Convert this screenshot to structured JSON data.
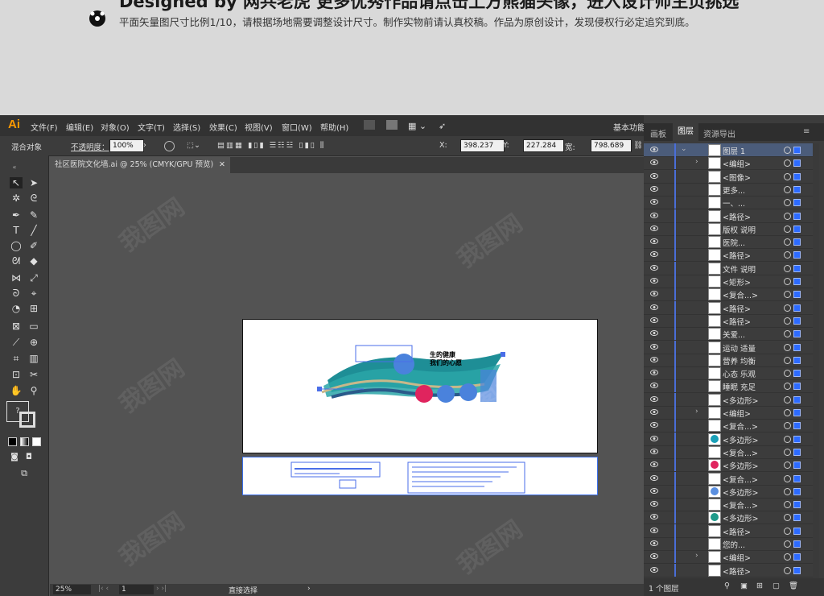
{
  "banner": {
    "headline": "Designed by 网共老虎    更多优秀作品请点击上方熊猫头像，进入设计师主页挑选",
    "subline": "平面矢量图尺寸比例1/10，请根据场地需要调整设计尺寸。制作实物前请认真校稿。作品为原创设计，发现侵权行必定追究到底。"
  },
  "app": {
    "logo": "Ai",
    "menu": [
      "文件(F)",
      "编辑(E)",
      "对象(O)",
      "文字(T)",
      "选择(S)",
      "效果(C)",
      "视图(V)",
      "窗口(W)",
      "帮助(H)"
    ],
    "workspace": "基本功能",
    "control": {
      "mode_label": "混合对象",
      "opacity_label": "不透明度：",
      "opacity_value": "100%",
      "x_label": "X:",
      "x_value": "398.237",
      "y_label": "Y:",
      "y_value": "227.284",
      "w_label": "宽:",
      "w_value": "798.689"
    },
    "document_tab": "社区医院文化墙.ai @ 25% (CMYK/GPU 预览)",
    "status": {
      "zoom": "25%",
      "page": "1",
      "tool": "直接选择"
    },
    "artwork": {
      "line1": "生的健康",
      "line2": "我们的心愿"
    }
  },
  "panel": {
    "tabs": [
      "画板",
      "图层",
      "资源导出"
    ],
    "active_tab": "图层",
    "layers": [
      {
        "name": "图层 1",
        "top": true
      },
      {
        "name": "<编组>",
        "caret": true
      },
      {
        "name": "<图像>"
      },
      {
        "name": "更多..."
      },
      {
        "name": "一、..."
      },
      {
        "name": "<路径>"
      },
      {
        "name": "版权 说明"
      },
      {
        "name": "医院..."
      },
      {
        "name": "<路径>"
      },
      {
        "name": "文件 说明"
      },
      {
        "name": "<矩形>"
      },
      {
        "name": "<复合...>"
      },
      {
        "name": "<路径>"
      },
      {
        "name": "<路径>"
      },
      {
        "name": "关爱..."
      },
      {
        "name": "运动 适量"
      },
      {
        "name": "营养 均衡"
      },
      {
        "name": "心态 乐观"
      },
      {
        "name": "睡眠 充足"
      },
      {
        "name": "<多边形>"
      },
      {
        "name": "<编组>",
        "caret": true
      },
      {
        "name": "<复合...>"
      },
      {
        "name": "<多边形>",
        "color": "#1aa0b8"
      },
      {
        "name": "<复合...>"
      },
      {
        "name": "<多边形>",
        "color": "#e0245e"
      },
      {
        "name": "<复合...>"
      },
      {
        "name": "<多边形>",
        "color": "#5a8fe0"
      },
      {
        "name": "<复合...>"
      },
      {
        "name": "<多边形>",
        "color": "#1e9a8a"
      },
      {
        "name": "<路径>"
      },
      {
        "name": "您的..."
      },
      {
        "name": "<编组>",
        "caret": true
      },
      {
        "name": "<路径>"
      }
    ],
    "footer": "1 个图层"
  }
}
